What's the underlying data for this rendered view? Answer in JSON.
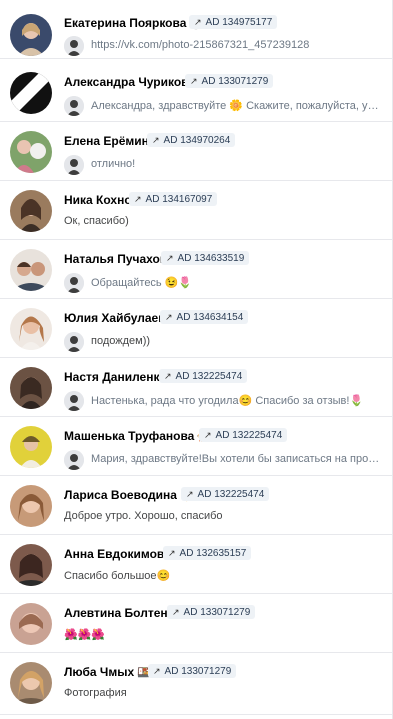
{
  "conversations": [
    {
      "name": "Екатерина Пояркова",
      "emoji": "🍷",
      "ad": "AD 134975177",
      "message": "https://vk.com/photo-215867321_457239128",
      "reply": true,
      "avatar_color": "#3a4a6b"
    },
    {
      "name": "Александра Чурикова",
      "emoji": "",
      "ad": "AD 133071279",
      "message": "Александра, здравствуйте 🌼 Скажите, пожалуйста, уж...",
      "reply": true,
      "avatar_color": "#111111"
    },
    {
      "name": "Елена Ерёмина",
      "emoji": "",
      "ad": "AD 134970264",
      "message": "отлично!",
      "reply": true,
      "avatar_color": "#7fa36a"
    },
    {
      "name": "Ника Кохно",
      "emoji": "",
      "ad": "AD 134167097",
      "message": "Ок, спасибо)",
      "reply": false,
      "avatar_color": "#9a7b5e"
    },
    {
      "name": "Наталья Пучахова",
      "emoji": "",
      "ad": "AD 134633519",
      "message": "Обращайтесь 😉🌷",
      "reply": true,
      "avatar_color": "#b0a49a"
    },
    {
      "name": "Юлия Хайбулаева",
      "emoji": "",
      "ad": "AD 134634154",
      "message": "подождем))",
      "reply": true,
      "avatar_color": "#c69a7a"
    },
    {
      "name": "Настя Даниленко",
      "emoji": "",
      "ad": "AD 132225474",
      "message": "Настенька, рада что угодила😊 Спасибо за отзыв!🌷",
      "reply": true,
      "avatar_color": "#6b5243"
    },
    {
      "name": "Машенька Труфанова",
      "emoji": "🐅",
      "ad": "AD 132225474",
      "message": "Мария, здравствуйте!Вы хотели бы записаться на проц...",
      "reply": true,
      "avatar_color": "#e1d13a"
    },
    {
      "name": "Лариса Воеводина",
      "emoji": "👌",
      "ad": "AD 132225474",
      "message": "Доброе утро. Хорошо, спасибо",
      "reply": false,
      "avatar_color": "#c79a78"
    },
    {
      "name": "Анна Евдокимова",
      "emoji": "",
      "ad": "AD 132635157",
      "message": "Спасибо большое😊",
      "reply": false,
      "avatar_color": "#7d5a4c"
    },
    {
      "name": "Алевтина Болтенко",
      "emoji": "",
      "ad": "AD 133071279",
      "message": "🌺🌺🌺",
      "reply": false,
      "avatar_color": "#c9a293"
    },
    {
      "name": "Люба Чмых",
      "emoji": "🍱",
      "ad": "AD 133071279",
      "message": "Фотография",
      "reply": false,
      "avatar_color": "#a98b70"
    }
  ],
  "icons": {
    "ad_tag": "arrow-up-right-icon",
    "reply_avatar": "agent-avatar"
  }
}
